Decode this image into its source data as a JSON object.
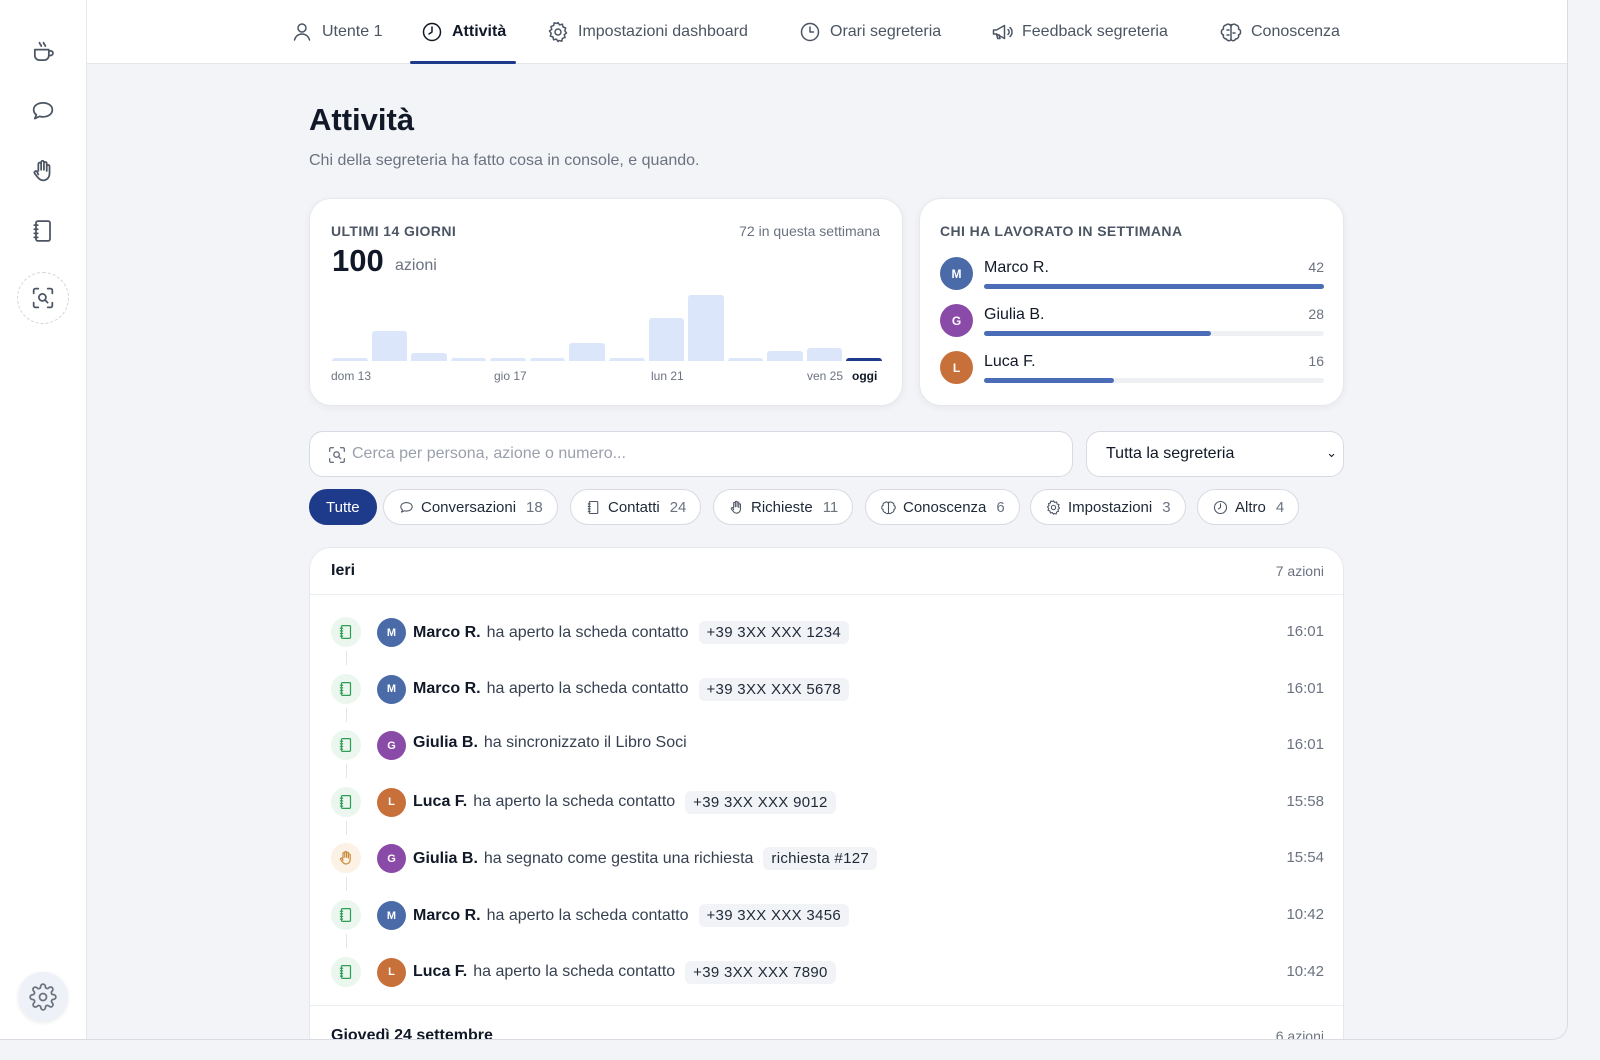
{
  "sidebar": {
    "items": [
      {
        "icon": "coffee-cup-icon"
      },
      {
        "icon": "chat-bubble-icon"
      },
      {
        "icon": "hand-icon"
      },
      {
        "icon": "notebook-icon"
      },
      {
        "icon": "scan-search-icon"
      }
    ],
    "settings_icon": "gear-icon"
  },
  "tabs": [
    {
      "label": "Utente 1",
      "icon": "user-icon"
    },
    {
      "label": "Attività",
      "icon": "clock-icon",
      "active": true
    },
    {
      "label": "Impostazioni dashboard",
      "icon": "gear-icon"
    },
    {
      "label": "Orari segreteria",
      "icon": "clock-icon"
    },
    {
      "label": "Feedback segreteria",
      "icon": "megaphone-icon"
    },
    {
      "label": "Conoscenza",
      "icon": "brain-icon"
    }
  ],
  "page": {
    "title": "Attività",
    "subtitle": "Chi della segreteria ha fatto cosa in console, e quando."
  },
  "summary": {
    "label": "ULTIMI 14 GIORNI",
    "total": "100",
    "unit": "azioni",
    "week": "72 in questa settimana",
    "x_labels": [
      "dom 13",
      "gio 17",
      "lun 21",
      "ven 25",
      "oggi"
    ]
  },
  "chart_data": {
    "type": "bar",
    "title": "ULTIMI 14 GIORNI",
    "categories": [
      "dom 13",
      "lun 14",
      "mar 15",
      "mer 16",
      "gio 17",
      "ven 18",
      "sab 19",
      "dom 20",
      "lun 21",
      "mar 22",
      "mer 23",
      "gio 24",
      "ven 25",
      "oggi"
    ],
    "values": [
      1,
      12,
      3,
      1,
      1,
      1,
      7,
      1,
      17,
      26,
      1,
      4,
      5,
      1
    ],
    "highlight_last": true
  },
  "workers": {
    "label": "CHI HA LAVORATO IN SETTIMANA",
    "max": 42,
    "items": [
      {
        "initial": "M",
        "name": "Marco R.",
        "count": 42,
        "count_label": "42",
        "color": "#4a6aa8"
      },
      {
        "initial": "G",
        "name": "Giulia B.",
        "count": 28,
        "count_label": "28",
        "color": "#8a4aa8"
      },
      {
        "initial": "L",
        "name": "Luca F.",
        "count": 16,
        "count_label": "16",
        "color": "#c8703a"
      }
    ]
  },
  "search": {
    "placeholder": "Cerca per persona, azione o numero...",
    "value": ""
  },
  "filter": {
    "selected": "Tutta la segreteria"
  },
  "chips": [
    {
      "label": "Tutte",
      "count": "",
      "icon": "",
      "active": true
    },
    {
      "label": "Conversazioni",
      "count": "18",
      "icon": "chat-bubble-icon"
    },
    {
      "label": "Contatti",
      "count": "24",
      "icon": "notebook-icon"
    },
    {
      "label": "Richieste",
      "count": "11",
      "icon": "hand-icon"
    },
    {
      "label": "Conoscenza",
      "count": "6",
      "icon": "brain-icon"
    },
    {
      "label": "Impostazioni",
      "count": "3",
      "icon": "gear-icon"
    },
    {
      "label": "Altro",
      "count": "4",
      "icon": "clock-icon"
    }
  ],
  "groups": [
    {
      "title": "Ieri",
      "count": "7 azioni",
      "rows": [
        {
          "kind": "contact",
          "kind_icon": "notebook-icon",
          "initial": "M",
          "color": "#4a6aa8",
          "who": "Marco R.",
          "action": "ha aperto la scheda contatto",
          "ref": "+39 3XX XXX 1234",
          "time": "16:01"
        },
        {
          "kind": "contact",
          "kind_icon": "notebook-icon",
          "initial": "M",
          "color": "#4a6aa8",
          "who": "Marco R.",
          "action": "ha aperto la scheda contatto",
          "ref": "+39 3XX XXX 5678",
          "time": "16:01"
        },
        {
          "kind": "contact",
          "kind_icon": "notebook-icon",
          "initial": "G",
          "color": "#8a4aa8",
          "who": "Giulia B.",
          "action": "ha sincronizzato il Libro Soci",
          "ref": "",
          "time": "16:01"
        },
        {
          "kind": "contact",
          "kind_icon": "notebook-icon",
          "initial": "L",
          "color": "#c8703a",
          "who": "Luca F.",
          "action": "ha aperto la scheda contatto",
          "ref": "+39 3XX XXX 9012",
          "time": "15:58"
        },
        {
          "kind": "request",
          "kind_icon": "hand-icon",
          "initial": "G",
          "color": "#8a4aa8",
          "who": "Giulia B.",
          "action": "ha segnato come gestita una richiesta",
          "ref": "richiesta #127",
          "time": "15:54"
        },
        {
          "kind": "contact",
          "kind_icon": "notebook-icon",
          "initial": "M",
          "color": "#4a6aa8",
          "who": "Marco R.",
          "action": "ha aperto la scheda contatto",
          "ref": "+39 3XX XXX 3456",
          "time": "10:42"
        },
        {
          "kind": "contact",
          "kind_icon": "notebook-icon",
          "initial": "L",
          "color": "#c8703a",
          "who": "Luca F.",
          "action": "ha aperto la scheda contatto",
          "ref": "+39 3XX XXX 7890",
          "time": "10:42"
        }
      ]
    },
    {
      "title": "Giovedì 24 settembre",
      "count": "6 azioni",
      "rows": []
    }
  ]
}
